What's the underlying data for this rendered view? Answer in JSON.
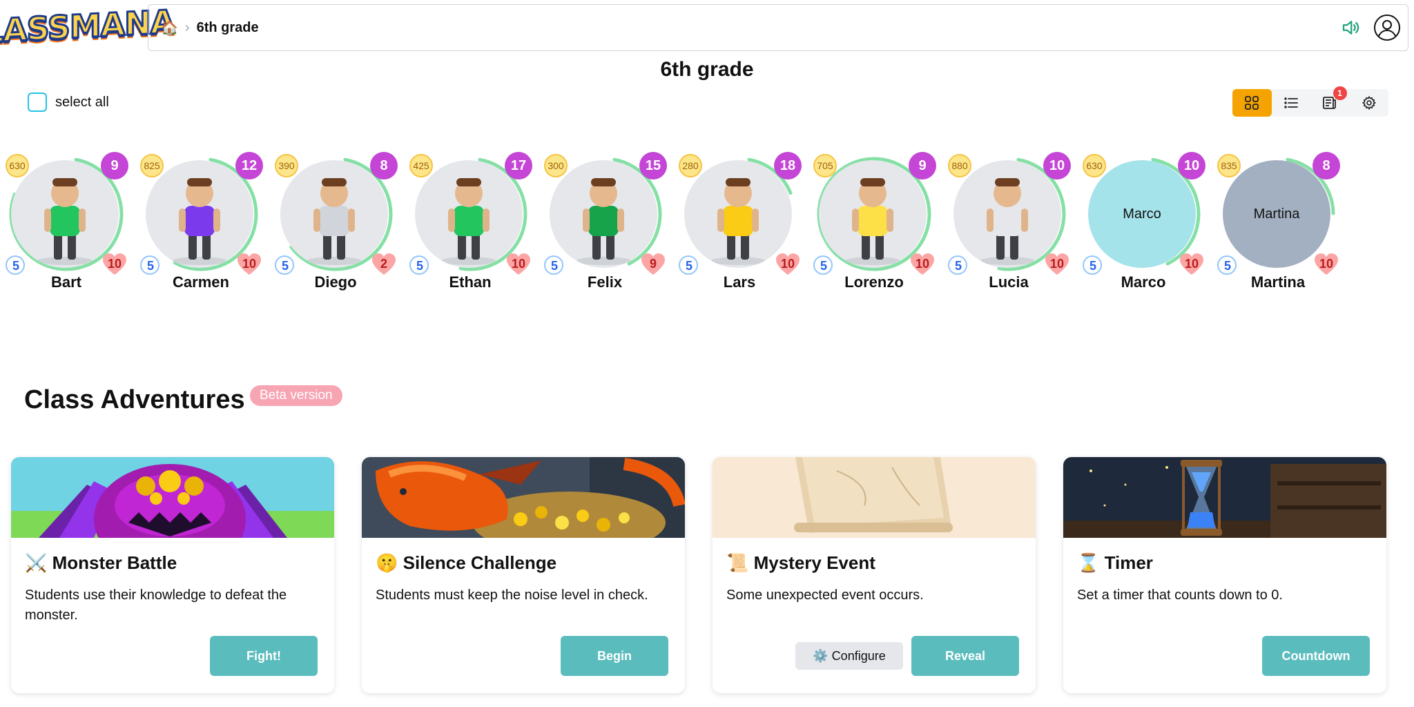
{
  "app": {
    "logo_text": "CLASSMANA"
  },
  "breadcrumb": {
    "home_icon": "home-icon",
    "current": "6th grade"
  },
  "page": {
    "title": "6th grade"
  },
  "select_all": {
    "label": "select all"
  },
  "view_toolbar": {
    "notification_count": "1",
    "active_color": "#f4a300"
  },
  "students": [
    {
      "name": "Bart",
      "coins": "630",
      "level": "9",
      "mana": "5",
      "hearts": "10",
      "avatar_text": ""
    },
    {
      "name": "Carmen",
      "coins": "825",
      "level": "12",
      "mana": "5",
      "hearts": "10",
      "avatar_text": ""
    },
    {
      "name": "Diego",
      "coins": "390",
      "level": "8",
      "mana": "5",
      "hearts": "2",
      "avatar_text": ""
    },
    {
      "name": "Ethan",
      "coins": "425",
      "level": "17",
      "mana": "5",
      "hearts": "10",
      "avatar_text": ""
    },
    {
      "name": "Felix",
      "coins": "300",
      "level": "15",
      "mana": "5",
      "hearts": "9",
      "avatar_text": ""
    },
    {
      "name": "Lars",
      "coins": "280",
      "level": "18",
      "mana": "5",
      "hearts": "10",
      "avatar_text": ""
    },
    {
      "name": "Lorenzo",
      "coins": "705",
      "level": "9",
      "mana": "5",
      "hearts": "10",
      "avatar_text": ""
    },
    {
      "name": "Lucia",
      "coins": "880",
      "level": "10",
      "mana": "5",
      "hearts": "10",
      "avatar_text": ""
    },
    {
      "name": "Marco",
      "coins": "630",
      "level": "10",
      "mana": "5",
      "hearts": "10",
      "avatar_text": "Marco"
    },
    {
      "name": "Martina",
      "coins": "835",
      "level": "8",
      "mana": "5",
      "hearts": "10",
      "avatar_text": "Martina"
    }
  ],
  "student_progress": [
    0.78,
    0.55,
    0.62,
    0.5,
    0.4,
    0.16,
    1.0,
    0.5,
    0.4,
    0.22
  ],
  "student_bg_colors": [
    "#e5e7eb",
    "#e5e7eb",
    "#e5e7eb",
    "#e5e7eb",
    "#e5e7eb",
    "#e5e7eb",
    "#e5e7eb",
    "#e5e7eb",
    "#a5e3ea",
    "#a3b0c2"
  ],
  "adventures": {
    "title": "Class Adventures",
    "badge": "Beta version",
    "cards": [
      {
        "title": "⚔️ Monster Battle",
        "description": "Students use their knowledge to defeat the monster.",
        "primary": "Fight!",
        "secondary": ""
      },
      {
        "title": "🤫 Silence Challenge",
        "description": "Students must keep the noise level in check.",
        "primary": "Begin",
        "secondary": ""
      },
      {
        "title": "📜 Mystery Event",
        "description": "Some unexpected event occurs.",
        "primary": "Reveal",
        "secondary": "⚙️ Configure"
      },
      {
        "title": "⌛ Timer",
        "description": "Set a timer that counts down to 0.",
        "primary": "Countdown",
        "secondary": ""
      }
    ]
  }
}
